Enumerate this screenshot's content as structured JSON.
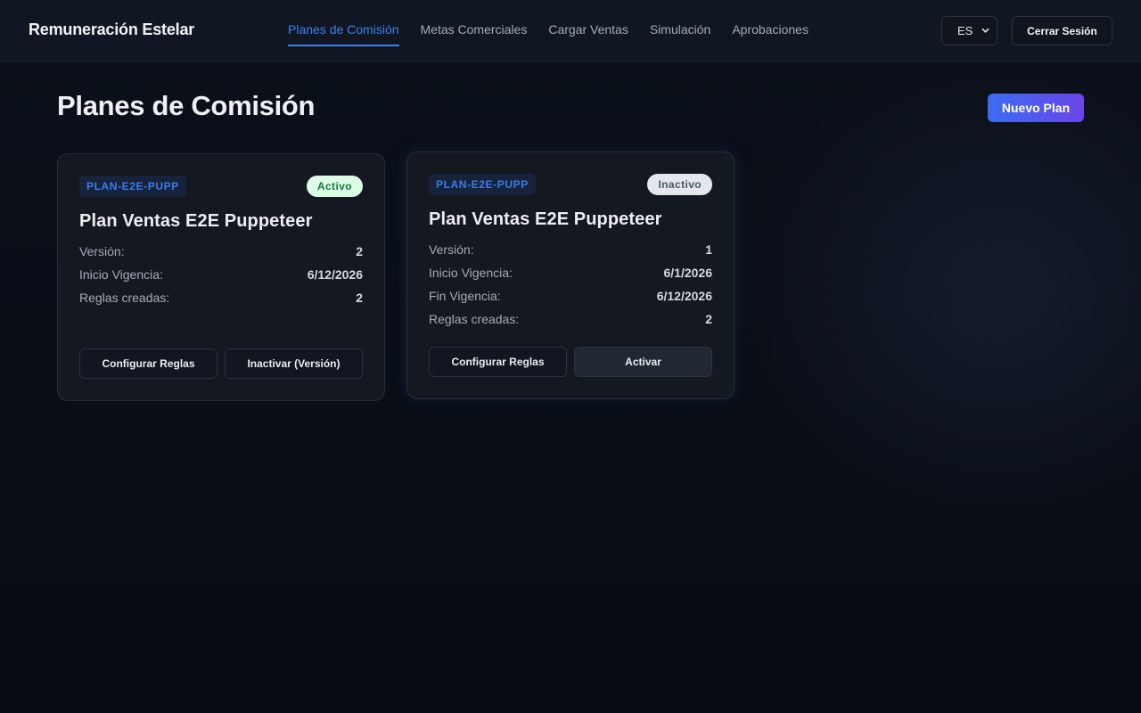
{
  "header": {
    "brand": "Remuneración Estelar",
    "nav": [
      {
        "label": "Planes de Comisión",
        "active": true
      },
      {
        "label": "Metas Comerciales",
        "active": false
      },
      {
        "label": "Cargar Ventas",
        "active": false
      },
      {
        "label": "Simulación",
        "active": false
      },
      {
        "label": "Aprobaciones",
        "active": false
      }
    ],
    "language": "ES",
    "logout_label": "Cerrar Sesión"
  },
  "page": {
    "title": "Planes de Comisión",
    "new_plan_label": "Nuevo Plan"
  },
  "plans": [
    {
      "code": "PLAN-E2E-PUPP",
      "status": "Activo",
      "name": "Plan Ventas E2E Puppeteer",
      "rows": [
        {
          "key": "Versión:",
          "value": "2"
        },
        {
          "key": "Inicio Vigencia:",
          "value": "6/12/2026"
        },
        {
          "key": "Reglas creadas:",
          "value": "2"
        }
      ],
      "primary_action": "Configurar Reglas",
      "secondary_action": "Inactivar (Versión)"
    },
    {
      "code": "PLAN-E2E-PUPP",
      "status": "Inactivo",
      "name": "Plan Ventas E2E Puppeteer",
      "rows": [
        {
          "key": "Versión:",
          "value": "1"
        },
        {
          "key": "Inicio Vigencia:",
          "value": "6/1/2026"
        },
        {
          "key": "Fin Vigencia:",
          "value": "6/12/2026"
        },
        {
          "key": "Reglas creadas:",
          "value": "2"
        }
      ],
      "primary_action": "Configurar Reglas",
      "secondary_action": "Activar"
    }
  ],
  "colors": {
    "accent": "#3c7ff0",
    "status_active_bg": "#dcfce7",
    "status_active_text": "#15803d",
    "status_inactive_bg": "#e5e7eb",
    "status_inactive_text": "#4b5563",
    "button_gradient_start": "#3b6cf0",
    "button_gradient_end": "#6a45e8"
  }
}
